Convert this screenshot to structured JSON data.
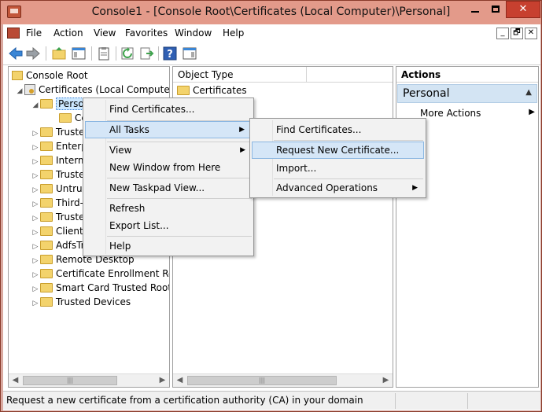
{
  "window": {
    "title": "Console1 - [Console Root\\Certificates (Local Computer)\\Personal]",
    "controls": {
      "minimize": "minimize",
      "maximize": "maximize",
      "close": "✕"
    }
  },
  "menubar": {
    "items": [
      "File",
      "Action",
      "View",
      "Favorites",
      "Window",
      "Help"
    ],
    "mdi_controls": [
      "_",
      "🗗",
      "✕"
    ]
  },
  "toolbar": {
    "buttons": [
      "back-icon",
      "forward-icon",
      "up-folder-icon",
      "show-hide-tree-icon",
      "properties-icon",
      "refresh-icon",
      "export-list-icon",
      "help-icon",
      "show-hide-action-pane-icon"
    ]
  },
  "tree": {
    "items": [
      {
        "label": "Console Root"
      },
      {
        "label": "Certificates (Local Computer)"
      },
      {
        "label": "Personal"
      },
      {
        "label": "Ce"
      },
      {
        "label": "Truste"
      },
      {
        "label": "Enterp"
      },
      {
        "label": "Interm"
      },
      {
        "label": "Truste"
      },
      {
        "label": "Untrus"
      },
      {
        "label": "Third-"
      },
      {
        "label": "Truste"
      },
      {
        "label": "Client"
      },
      {
        "label": "AdfsTr"
      },
      {
        "label": "Remote Desktop"
      },
      {
        "label": "Certificate Enrollment Requ"
      },
      {
        "label": "Smart Card Trusted Roots"
      },
      {
        "label": "Trusted Devices"
      }
    ]
  },
  "list": {
    "column_header": "Object Type",
    "rows": [
      {
        "label": "Certificates"
      }
    ]
  },
  "actions": {
    "header": "Actions",
    "section": "Personal",
    "items": [
      {
        "label": "More Actions"
      }
    ]
  },
  "context_menu": {
    "items": [
      "Find Certificates...",
      "All Tasks",
      "View",
      "New Window from Here",
      "New Taskpad View...",
      "Refresh",
      "Export List...",
      "Help"
    ]
  },
  "submenu": {
    "items": [
      "Find Certificates...",
      "Request New Certificate...",
      "Import...",
      "Advanced Operations"
    ]
  },
  "status": {
    "text": "Request a new certificate from a certification authority (CA) in your domain"
  },
  "colors": {
    "title_bar": "#e39a8a",
    "close_button": "#c7402f",
    "highlight": "#d5e6f7",
    "actions_section": "#d3e4f3",
    "folder": "#f3d36c"
  }
}
